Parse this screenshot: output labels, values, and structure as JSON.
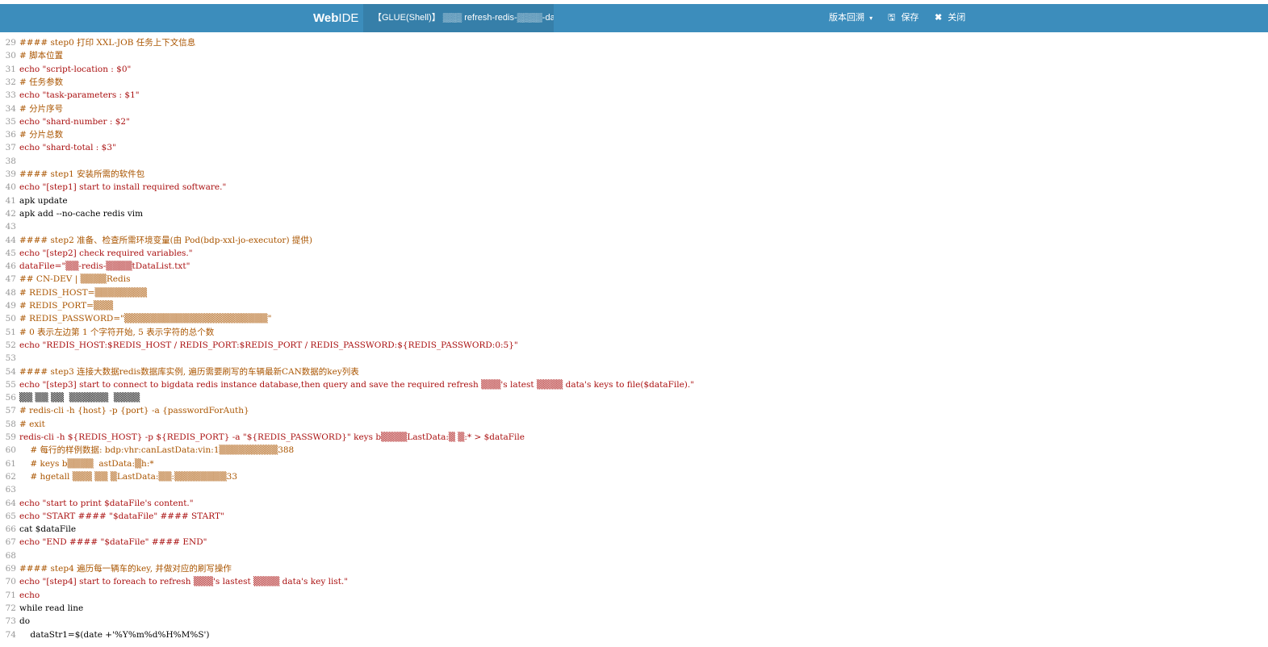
{
  "header": {
    "brand": {
      "web": "Web",
      "ide": "IDE"
    },
    "tab_label": "【GLUE(Shell)】 ▒▒▒ refresh-redis-▒▒▒▒-data",
    "menu": {
      "version": "版本回溯",
      "save": "保存",
      "close": "关闭"
    },
    "icons": {
      "version": "chevron-down-icon",
      "save": "save-icon",
      "close": "close-icon"
    },
    "colors": {
      "bar": "#3c8dbc",
      "active_tab": "#367fa9"
    }
  },
  "editor": {
    "lines": [
      {
        "n": "29",
        "t": "#### step0 打印 XXL-JOB 任务上下文信息"
      },
      {
        "n": "30",
        "t": "# 脚本位置"
      },
      {
        "n": "31",
        "t": "echo \"script-location : $0\""
      },
      {
        "n": "32",
        "t": "# 任务参数"
      },
      {
        "n": "33",
        "t": "echo \"task-parameters : $1\""
      },
      {
        "n": "34",
        "t": "# 分片序号"
      },
      {
        "n": "35",
        "t": "echo \"shard-number : $2\""
      },
      {
        "n": "36",
        "t": "# 分片总数"
      },
      {
        "n": "37",
        "t": "echo \"shard-total : $3\""
      },
      {
        "n": "38",
        "t": ""
      },
      {
        "n": "39",
        "t": "#### step1 安装所需的软件包"
      },
      {
        "n": "40",
        "t": "echo \"[step1] start to install required software.\""
      },
      {
        "n": "41",
        "t": "apk update"
      },
      {
        "n": "42",
        "t": "apk add --no-cache redis vim"
      },
      {
        "n": "43",
        "t": ""
      },
      {
        "n": "44",
        "t": "#### step2 准备、检查所需环境变量(由 Pod(bdp-xxl-jo-executor) 提供)"
      },
      {
        "n": "45",
        "t": "echo \"[step2] check required variables.\""
      },
      {
        "n": "46",
        "t": "dataFile=\"▒▒-redis-▒▒▒▒tDataList.txt\""
      },
      {
        "n": "47",
        "t": "## CN-DEV | ▒▒▒▒Redis"
      },
      {
        "n": "48",
        "t": "# REDIS_HOST=▒▒▒▒▒▒▒▒"
      },
      {
        "n": "49",
        "t": "# REDIS_PORT=▒▒▒"
      },
      {
        "n": "50",
        "t": "# REDIS_PASSWORD=\"▒▒▒▒▒▒▒▒▒▒▒▒▒▒▒▒▒▒▒▒▒▒\""
      },
      {
        "n": "51",
        "t": "# 0 表示左边第 1 个字符开始, 5 表示字符的总个数"
      },
      {
        "n": "52",
        "t": "echo \"REDIS_HOST:$REDIS_HOST / REDIS_PORT:$REDIS_PORT / REDIS_PASSWORD:${REDIS_PASSWORD:0:5}\""
      },
      {
        "n": "53",
        "t": ""
      },
      {
        "n": "54",
        "t": "#### step3 连接大数据redis数据库实例, 遍历需要刷写的车辆最新CAN数据的key列表"
      },
      {
        "n": "55",
        "t": "echo \"[step3] start to connect to bigdata redis instance database,then query and save the required refresh ▒▒▒'s latest ▒▒▒▒ data's keys to file($dataFile).\""
      },
      {
        "n": "56",
        "t": "▒▒ ▒▒ ▒▒  ▒▒▒▒▒▒  ▒▒▒▒"
      },
      {
        "n": "57",
        "t": "# redis-cli -h {host} -p {port} -a {passwordForAuth}"
      },
      {
        "n": "58",
        "t": "# exit"
      },
      {
        "n": "59",
        "t": "redis-cli -h ${REDIS_HOST} -p ${REDIS_PORT} -a \"${REDIS_PASSWORD}\" keys b▒▒▒▒LastData:▒ ▒:* > $dataFile"
      },
      {
        "n": "60",
        "t": "    # 每行的样例数据: bdp:vhr:canLastData:vin:1▒▒▒▒▒▒▒▒▒388"
      },
      {
        "n": "61",
        "t": "    # keys b▒▒▒▒  astData:▒h:*"
      },
      {
        "n": "62",
        "t": "    # hgetall ▒▒▒ ▒▒ ▒LastData:▒▒:▒▒▒▒▒▒▒▒33"
      },
      {
        "n": "63",
        "t": ""
      },
      {
        "n": "64",
        "t": "echo \"start to print $dataFile's content.\""
      },
      {
        "n": "65",
        "t": "echo \"START #### \"$dataFile\" #### START\""
      },
      {
        "n": "66",
        "t": "cat $dataFile"
      },
      {
        "n": "67",
        "t": "echo \"END #### \"$dataFile\" #### END\""
      },
      {
        "n": "68",
        "t": ""
      },
      {
        "n": "69",
        "t": "#### step4 遍历每一辆车的key, 并做对应的刷写操作"
      },
      {
        "n": "70",
        "t": "echo \"[step4] start to foreach to refresh ▒▒▒'s lastest ▒▒▒▒ data's key list.\""
      },
      {
        "n": "71",
        "t": "echo"
      },
      {
        "n": "72",
        "t": "while read line"
      },
      {
        "n": "73",
        "t": "do"
      },
      {
        "n": "74",
        "t": "    dataStr1=$(date +'%Y%m%d%H%M%S')"
      }
    ]
  }
}
